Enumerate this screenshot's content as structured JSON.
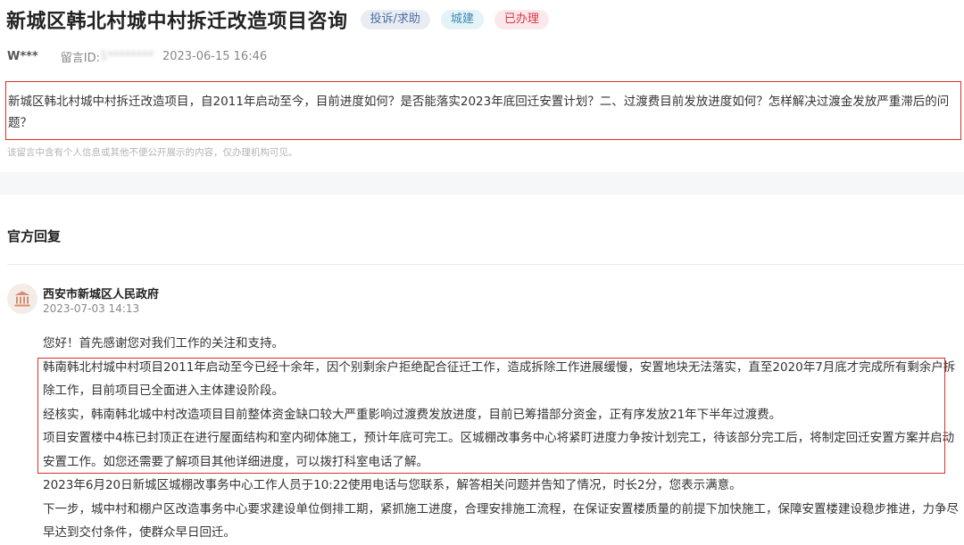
{
  "header": {
    "title": "新城区韩北村城中村拆迁改造项目咨询",
    "tags": {
      "type": "投诉/求助",
      "domain": "城建",
      "status": "已办理"
    }
  },
  "meta": {
    "user": "W***",
    "id_label": "留言ID:",
    "id_value": "1********",
    "datetime": "2023-06-15 16:46"
  },
  "question": {
    "text": "新城区韩北村城中村拆迁改造项目，自2011年启动至今，目前进度如何？是否能落实2023年底回迁安置计划？二、过渡费目前发放进度如何？怎样解决过渡金发放严重滞后的问题？"
  },
  "privacy_note": "该留言中含有个人信息或其他不便公开展示的内容，仅办理机构可见。",
  "reply": {
    "heading": "官方回复",
    "org_name": "西安市新城区人民政府",
    "org_date": "2023-07-03 14:13",
    "org_icon": "government-building-icon",
    "paragraphs": [
      "您好！首先感谢您对我们工作的关注和支持。",
      "韩南韩北村城中村项目2011年启动至今已经十余年，因个别剩余户拒绝配合征迁工作，造成拆除工作进展缓慢，安置地块无法落实，直至2020年7月底才完成所有剩余户拆除工作，目前项目已全面进入主体建设阶段。",
      "经核实，韩南韩北城中村改造项目目前整体资金缺口较大严重影响过渡费发放进度，目前已筹措部分资金，正有序发放21年下半年过渡费。",
      "项目安置楼中4栋已封顶正在进行屋面结构和室内砌体施工，预计年底可完工。区城棚改事务中心将紧盯进度力争按计划完工，待该部分完工后，将制定回迁安置方案并启动安置工作。如您还需要了解项目其他详细进度，可以拨打科室电话了解。",
      "2023年6月20日新城区城棚改事务中心工作人员于10:22使用电话与您联系，解答相关问题并告知了情况，时长2分，您表示满意。",
      "下一步，城中村和棚户区改造事务中心要求建设单位倒排工期，紧抓施工进度，合理安排施工流程，在保证安置楼质量的前提下加快施工，保障安置楼建设稳步推进，力争尽早达到交付条件，使群众早日回迁。"
    ]
  },
  "colors": {
    "highlight_border": "#e02b2b",
    "tag_type_bg": "#e9edf3",
    "tag_domain_bg": "#e3f3f8",
    "tag_status_bg": "#fce8ea",
    "tag_status_text": "#d6374a"
  }
}
